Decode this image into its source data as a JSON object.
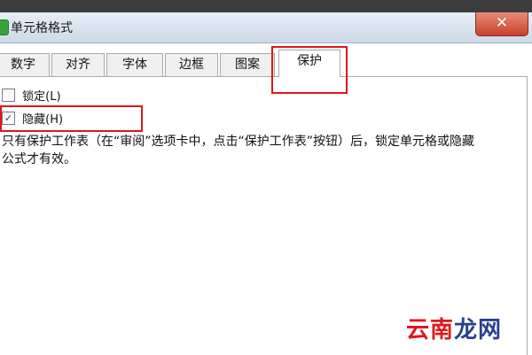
{
  "window": {
    "title": "单元格格式",
    "close_label": "✕"
  },
  "tabs": [
    {
      "label": "数字",
      "active": false
    },
    {
      "label": "对齐",
      "active": false
    },
    {
      "label": "字体",
      "active": false
    },
    {
      "label": "边框",
      "active": false
    },
    {
      "label": "图案",
      "active": false
    },
    {
      "label": "保护",
      "active": true
    }
  ],
  "protection": {
    "lock": {
      "label": "锁定(L)",
      "checked": false
    },
    "hide": {
      "label": "隐藏(H)",
      "checked": true
    }
  },
  "note": "只有保护工作表（在“审阅”选项卡中，点击“保护工作表”按钮）后，锁定单元格或隐藏公式才有效。",
  "watermark": {
    "red_text": "云南",
    "blue_text": "龙网"
  },
  "colors": {
    "highlight": "#e3141b",
    "title_bar": "#cdd9e7"
  }
}
